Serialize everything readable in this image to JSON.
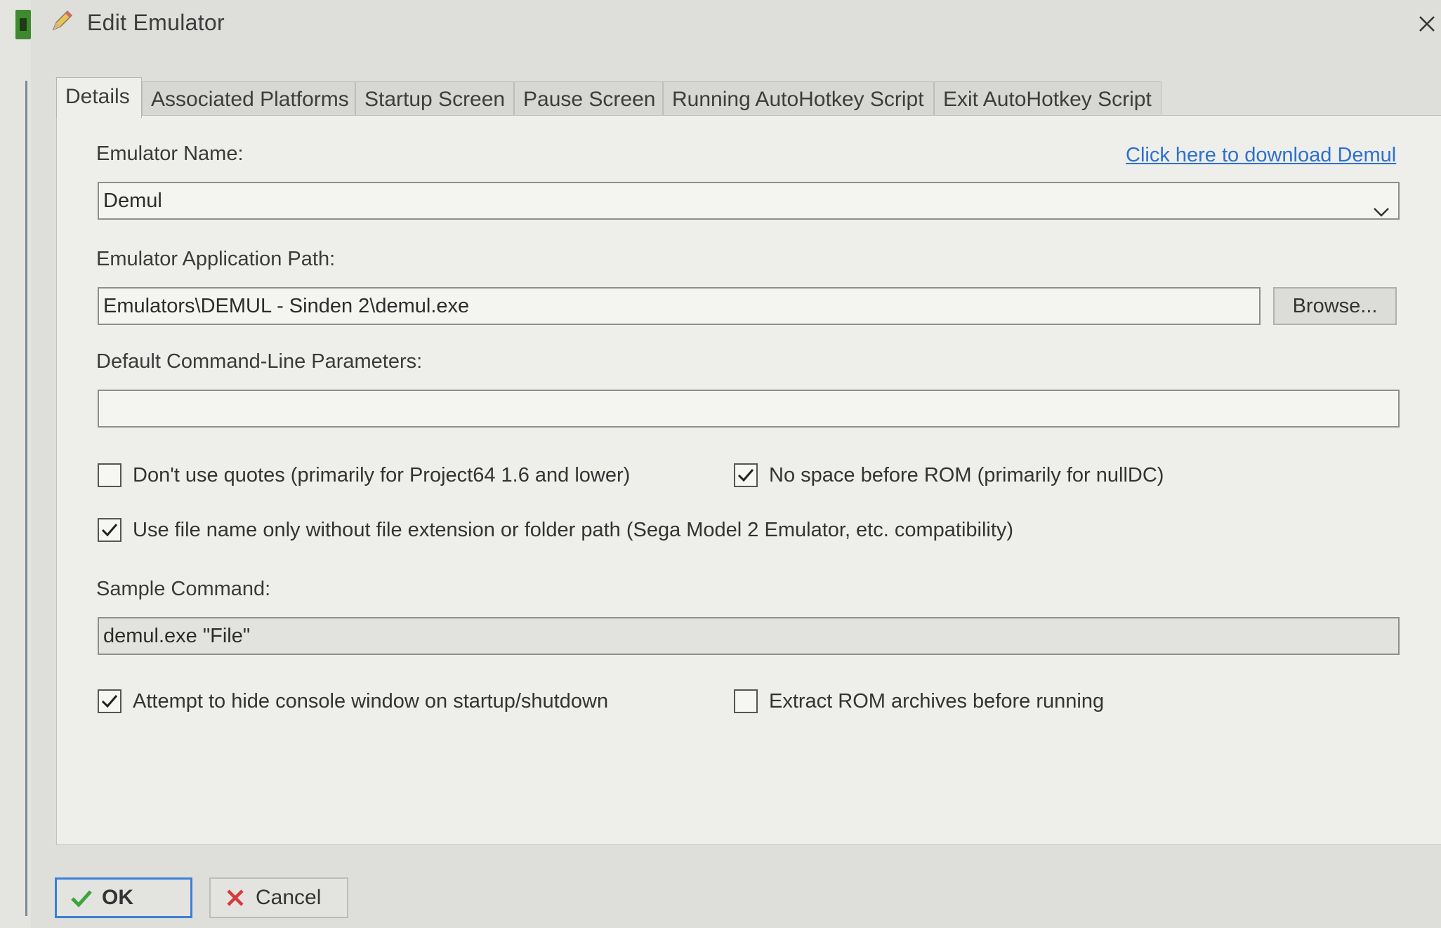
{
  "window": {
    "title": "Edit Emulator",
    "icons": {
      "title": "pencil-icon",
      "close": "close-icon"
    }
  },
  "tabs": [
    {
      "label": "Details",
      "active": true
    },
    {
      "label": "Associated Platforms",
      "active": false
    },
    {
      "label": "Startup Screen",
      "active": false
    },
    {
      "label": "Pause Screen",
      "active": false
    },
    {
      "label": "Running AutoHotkey Script",
      "active": false
    },
    {
      "label": "Exit AutoHotkey Script",
      "active": false
    }
  ],
  "details": {
    "emulator_name_label": "Emulator Name:",
    "download_link": "Click here to download Demul",
    "emulator_name_value": "Demul",
    "app_path_label": "Emulator Application Path:",
    "app_path_value": "Emulators\\DEMUL - Sinden 2\\demul.exe",
    "browse_label": "Browse...",
    "cmd_params_label": "Default Command-Line Parameters:",
    "cmd_params_value": "",
    "checkbox_dont_use_quotes": {
      "label": "Don't use quotes (primarily for Project64 1.6 and lower)",
      "checked": false
    },
    "checkbox_no_space_before_rom": {
      "label": "No space before ROM (primarily for nullDC)",
      "checked": true
    },
    "checkbox_file_name_only": {
      "label": "Use file name only without file extension or folder path (Sega Model 2 Emulator, etc. compatibility)",
      "checked": true
    },
    "sample_command_label": "Sample Command:",
    "sample_command_value": "demul.exe \"File\"",
    "checkbox_hide_console": {
      "label": "Attempt to hide console window on startup/shutdown",
      "checked": true
    },
    "checkbox_extract_rom": {
      "label": "Extract ROM archives before running",
      "checked": false
    }
  },
  "footer": {
    "ok_label": "OK",
    "cancel_label": "Cancel",
    "icons": {
      "ok": "checkmark-icon",
      "cancel": "red-x-icon"
    }
  },
  "colors": {
    "link": "#2f6fcf",
    "ok_check": "#3aa63a",
    "cancel_x": "#d63a3a",
    "focus_border": "#3b7fd6"
  }
}
